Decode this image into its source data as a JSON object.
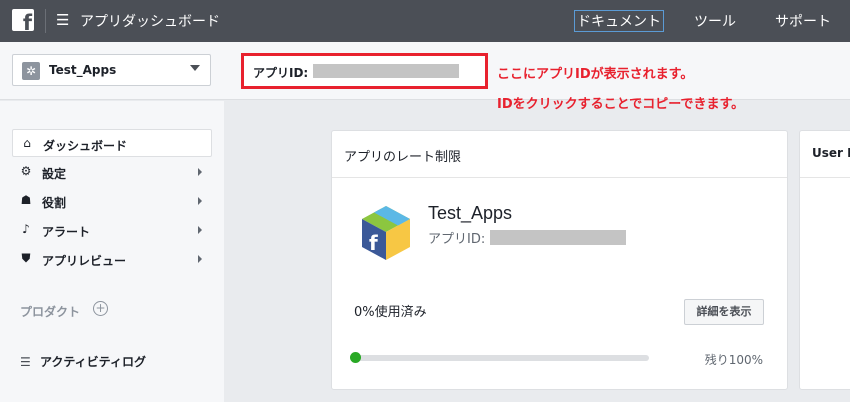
{
  "topbar": {
    "logo": "f",
    "menu_icon": "☰",
    "title": "アプリダッシュボード",
    "nav": {
      "docs": "ドキュメント",
      "tools": "ツール",
      "support": "サポート"
    }
  },
  "app_selector": {
    "name": "Test_Apps",
    "icon": "app-settings-icon"
  },
  "app_id": {
    "label": "アプリID:"
  },
  "annotations": {
    "line1": "ここにアプリIDが表示されます。",
    "line2": "IDをクリックすることでコピーできます。",
    "color": "#e8212e"
  },
  "sidebar": {
    "items": [
      {
        "label": "ダッシュボード",
        "icon": "home-icon",
        "glyph": "⌂"
      },
      {
        "label": "設定",
        "icon": "gear-icon",
        "glyph": "⚙"
      },
      {
        "label": "役割",
        "icon": "roles-icon",
        "glyph": "☗"
      },
      {
        "label": "アラート",
        "icon": "bell-icon",
        "glyph": "♪"
      },
      {
        "label": "アプリレビュー",
        "icon": "shield-icon",
        "glyph": "⛊"
      }
    ],
    "products_label": "プロダクト",
    "products_add": "+",
    "activity_label": "アクティビティログ",
    "activity_glyph": "☰"
  },
  "rate_card": {
    "title": "アプリのレート制限",
    "app_name": "Test_Apps",
    "app_id_label": "アプリID:",
    "usage_text": "0%使用済み",
    "usage_fraction": 0.0,
    "details_button": "詳細を表示",
    "remaining_text": "残り100%"
  },
  "second_card": {
    "title": "User R"
  },
  "colors": {
    "topbar": "#4b4f56",
    "progress": "#28a824",
    "highlight": "#e8212e"
  }
}
